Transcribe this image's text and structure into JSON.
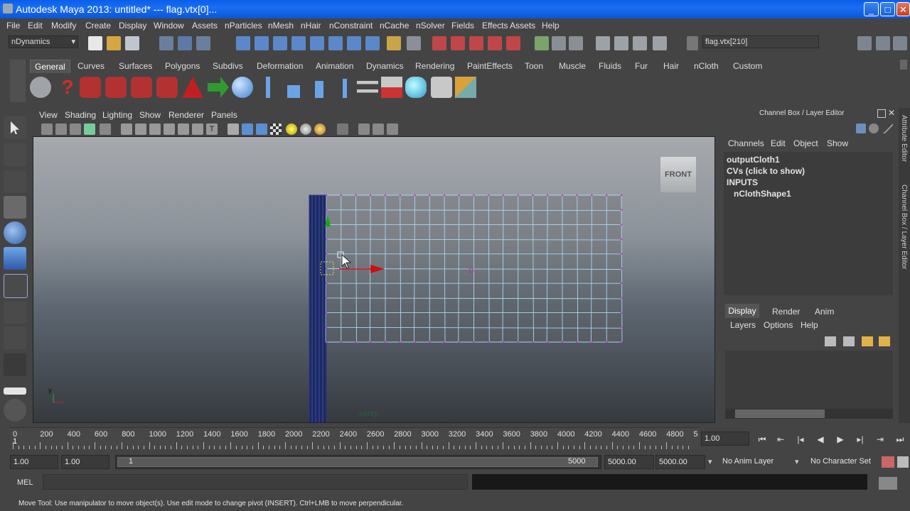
{
  "window": {
    "title": "Autodesk Maya 2013: untitled*   ---   flag.vtx[0]..."
  },
  "menubar": [
    "File",
    "Edit",
    "Modify",
    "Create",
    "Display",
    "Window",
    "Assets",
    "nParticles",
    "nMesh",
    "nHair",
    "nConstraint",
    "nCache",
    "nSolver",
    "Fields",
    "Effects Assets",
    "Help"
  ],
  "status": {
    "menuset": "nDynamics",
    "selection_field": "flag.vtx[210]"
  },
  "shelf": {
    "tabs": [
      "General",
      "Curves",
      "Surfaces",
      "Polygons",
      "Subdivs",
      "Deformation",
      "Animation",
      "Dynamics",
      "Rendering",
      "PaintEffects",
      "Toon",
      "Muscle",
      "Fluids",
      "Fur",
      "Hair",
      "nCloth",
      "Custom"
    ],
    "active": "General"
  },
  "panel": {
    "menus": [
      "View",
      "Shading",
      "Lighting",
      "Show",
      "Renderer",
      "Panels"
    ],
    "view_cube": "FRONT",
    "camera_label": "persp",
    "axis_y": "y"
  },
  "channelbox": {
    "title": "Channel Box / Layer Editor",
    "menus": [
      "Channels",
      "Edit",
      "Object",
      "Show"
    ],
    "object_name": "outputCloth1",
    "cvs": "CVs (click to show)",
    "inputs_label": "INPUTS",
    "input_node": "nClothShape1",
    "layer_tabs": [
      "Display",
      "Render",
      "Anim"
    ],
    "layer_menus": [
      "Layers",
      "Options",
      "Help"
    ]
  },
  "sidebar": {
    "attribute_editor": "Attribute Editor",
    "channel_box": "Channel Box / Layer Editor"
  },
  "timeslider": {
    "ticks": [
      "0",
      "200",
      "400",
      "600",
      "800",
      "1000",
      "1200",
      "1400",
      "1600",
      "1800",
      "2000",
      "2200",
      "2400",
      "2600",
      "2800",
      "3000",
      "3200",
      "3400",
      "3600",
      "3800",
      "4000",
      "4200",
      "4400",
      "4600",
      "4800",
      "5"
    ],
    "current_frame": "1",
    "current_time_field": "1.00"
  },
  "rangeslider": {
    "start_time": "1.00",
    "playback_start": "1.00",
    "range_start_label": "1",
    "range_end_label": "5000",
    "playback_end": "5000.00",
    "end_time": "5000.00",
    "anim_layer": "No Anim Layer",
    "character_set": "No Character Set"
  },
  "commandline": {
    "label": "MEL"
  },
  "helpline": {
    "text": "Move Tool: Use manipulator to move object(s). Use edit mode to change pivot (INSERT).  Ctrl+LMB to move perpendicular."
  }
}
